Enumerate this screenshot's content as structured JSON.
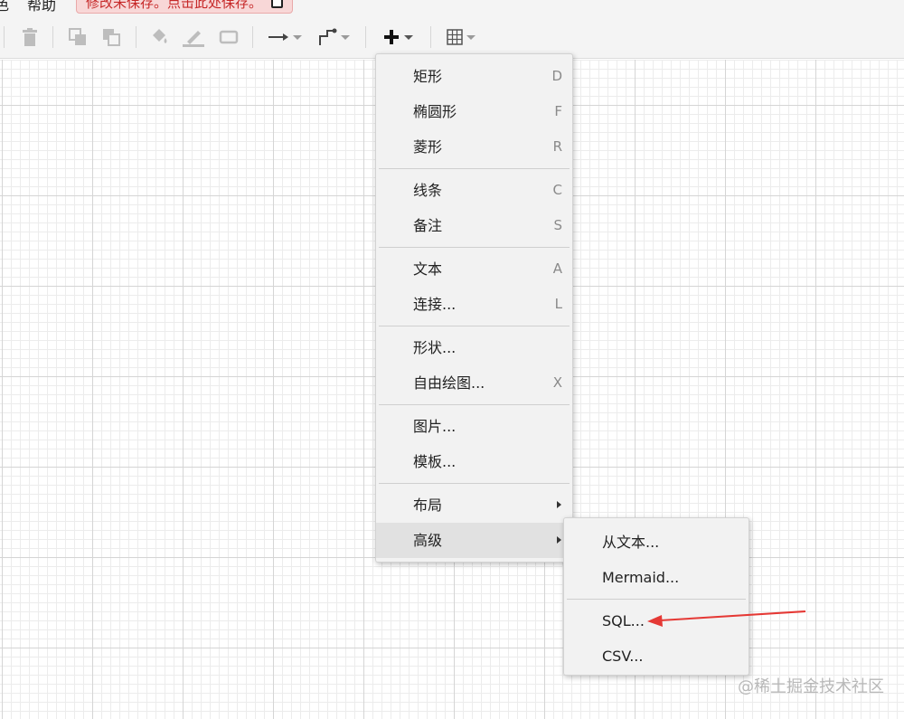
{
  "menubar": {
    "items": [
      "色",
      "帮助"
    ],
    "unsaved_notice": "修改未保存。点击此处保存。"
  },
  "toolbar": {
    "icons": [
      "delete-icon",
      "to-front-icon",
      "to-back-icon",
      "fill-color-icon",
      "line-color-icon",
      "shadow-icon",
      "connection-icon",
      "waypoints-icon",
      "insert-icon",
      "table-icon"
    ]
  },
  "insert_menu": {
    "groups": [
      [
        {
          "label": "矩形",
          "key": "D"
        },
        {
          "label": "椭圆形",
          "key": "F"
        },
        {
          "label": "菱形",
          "key": "R"
        }
      ],
      [
        {
          "label": "线条",
          "key": "C"
        },
        {
          "label": "备注",
          "key": "S"
        }
      ],
      [
        {
          "label": "文本",
          "key": "A"
        },
        {
          "label": "连接...",
          "key": "L"
        }
      ],
      [
        {
          "label": "形状...",
          "key": ""
        },
        {
          "label": "自由绘图...",
          "key": "X"
        }
      ],
      [
        {
          "label": "图片...",
          "key": ""
        },
        {
          "label": "模板...",
          "key": ""
        }
      ],
      [
        {
          "label": "布局",
          "key": "",
          "submenu": true
        },
        {
          "label": "高级",
          "key": "",
          "submenu": true,
          "highlighted": true
        }
      ]
    ]
  },
  "advanced_submenu": {
    "groups": [
      [
        {
          "label": "从文本..."
        },
        {
          "label": "Mermaid..."
        }
      ],
      [
        {
          "label": "SQL..."
        },
        {
          "label": "CSV..."
        }
      ]
    ]
  },
  "annotation": {
    "color": "#e53935"
  },
  "watermark": "@稀土掘金技术社区",
  "colors": {
    "toolbar_bg": "#f4f4f4",
    "menu_bg": "#f2f2f2",
    "highlight": "#e1e1e1",
    "notice_text": "#c62828"
  }
}
